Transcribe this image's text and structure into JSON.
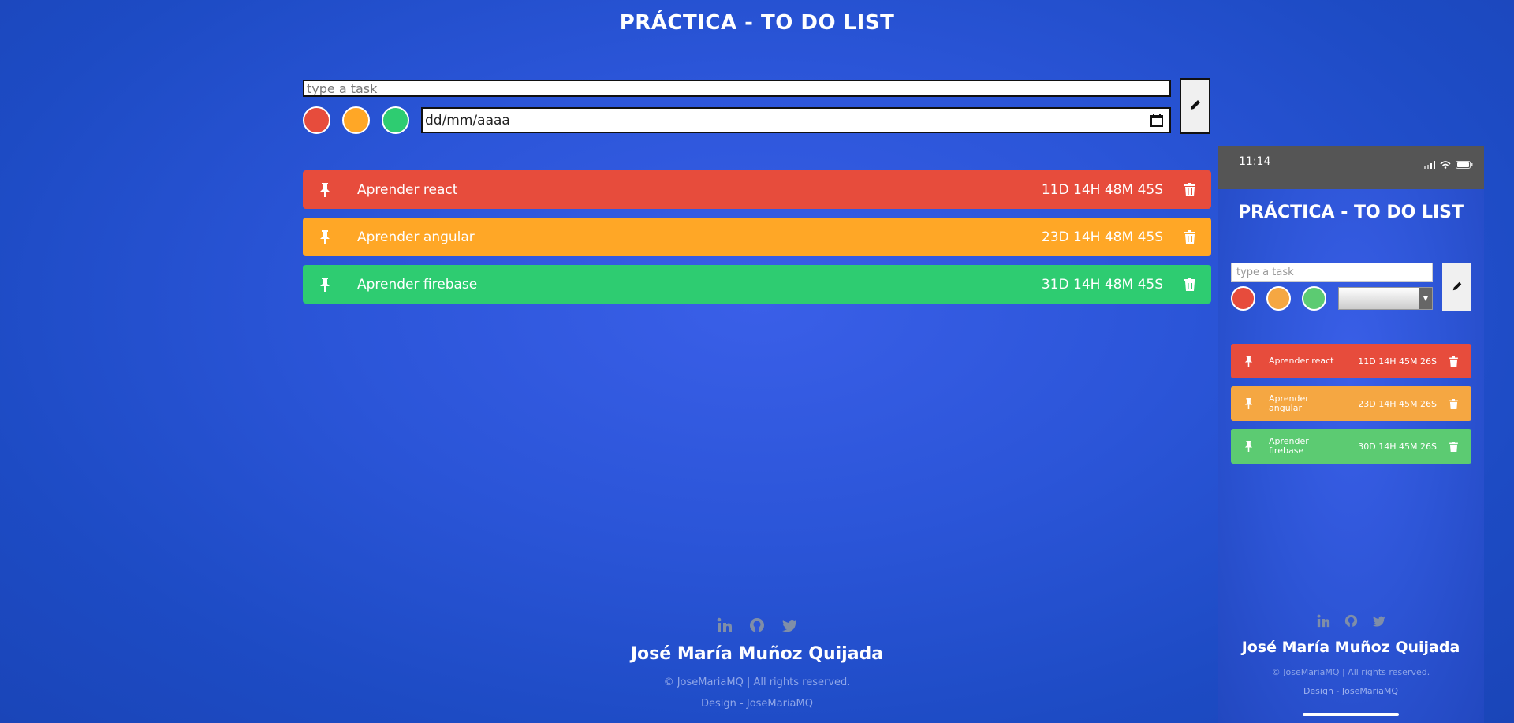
{
  "header": {
    "title": "PRÁCTICA - TO DO LIST"
  },
  "form": {
    "task_placeholder": "type a task",
    "date_placeholder": "dd/mm/aaaa",
    "colors": [
      "#e74c3c",
      "#ffa726",
      "#2ecc71"
    ]
  },
  "tasks": [
    {
      "label": "Aprender react",
      "countdown": "11D 14H 48M 45S",
      "color": "#e74c3c"
    },
    {
      "label": "Aprender angular",
      "countdown": "23D 14H 48M 45S",
      "color": "#ffa726"
    },
    {
      "label": "Aprender firebase",
      "countdown": "31D 14H 48M 45S",
      "color": "#2ecc71"
    }
  ],
  "footer": {
    "social_icons": [
      "linkedin-icon",
      "github-icon",
      "twitter-icon"
    ],
    "author": "José María Muñoz Quijada",
    "copyright": "© JoseMariaMQ | All rights reserved.",
    "design": "Design - JoseMariaMQ"
  },
  "phone": {
    "time": "11:14",
    "title": "PRÁCTICA - TO DO LIST",
    "task_placeholder": "type a task",
    "tasks": [
      {
        "label": "Aprender react",
        "countdown": "11D 14H 45M 26S",
        "color": "#e74c3c"
      },
      {
        "label": "Aprender angular",
        "countdown": "23D 14H 45M 26S",
        "color": "#f5a742"
      },
      {
        "label": "Aprender firebase",
        "countdown": "30D 14H 45M 26S",
        "color": "#5ccb72"
      }
    ],
    "author": "José María Muñoz Quijada",
    "copyright": "© JoseMariaMQ | All rights reserved.",
    "design": "Design - JoseMariaMQ"
  }
}
